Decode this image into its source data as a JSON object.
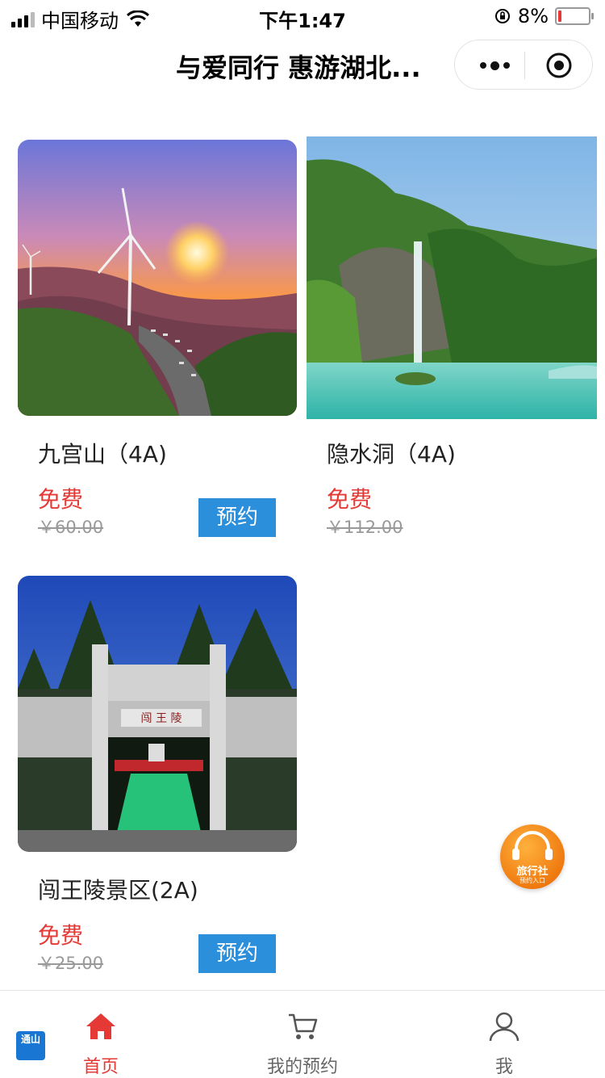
{
  "status_bar": {
    "carrier": "中国移动",
    "time": "下午1:47",
    "battery": "8%"
  },
  "navbar": {
    "title": "与爱同行 惠游湖北..."
  },
  "cards": [
    {
      "name": "九宫山（4A)",
      "price": "免费",
      "original_price": "￥60.00",
      "book_label": "预约"
    },
    {
      "name": "隐水洞（4A)",
      "price": "免费",
      "original_price": "￥112.00"
    },
    {
      "name": "闯王陵景区(2A)",
      "price": "免费",
      "original_price": "￥25.00",
      "book_label": "预约"
    }
  ],
  "fab": {
    "line1": "旅行社",
    "line2": "预约入口"
  },
  "logo": {
    "text": "通山"
  },
  "tabbar": {
    "items": [
      {
        "label": "首页",
        "icon": "home-icon",
        "active": true
      },
      {
        "label": "我的预约",
        "icon": "cart-icon",
        "active": false
      },
      {
        "label": "我",
        "icon": "user-icon",
        "active": false
      }
    ]
  },
  "colors": {
    "accent": "#e53935",
    "book_button": "#2b8fdc",
    "fab": "#ef7a10"
  }
}
